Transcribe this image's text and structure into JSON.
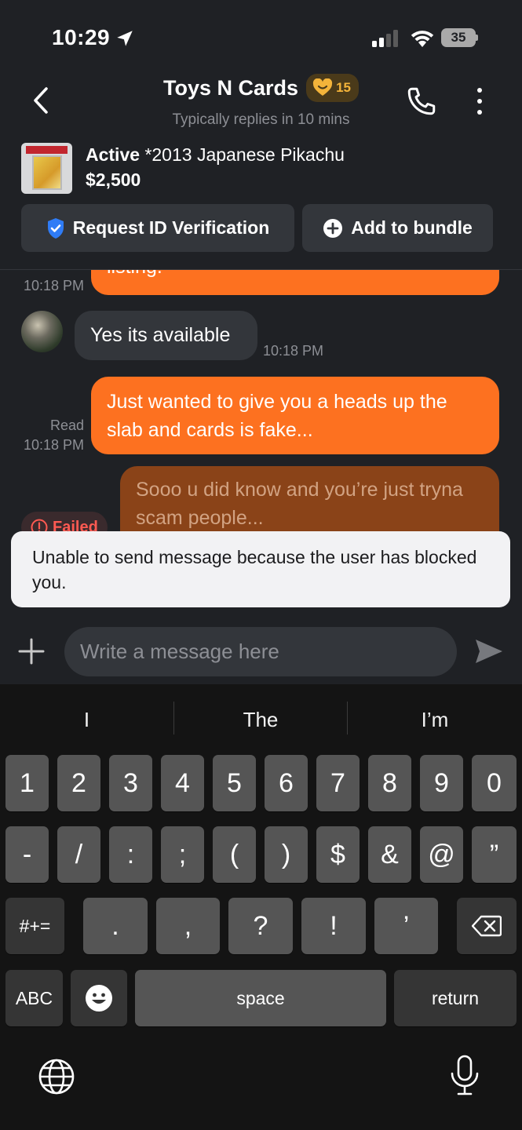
{
  "status_bar": {
    "time": "10:29",
    "battery": "35"
  },
  "header": {
    "title": "Toys N Cards",
    "badge_number": "15",
    "subtitle": "Typically replies in 10 mins"
  },
  "listing": {
    "status": "Active",
    "name": "*2013 Japanese Pikachu",
    "price": "$2,500",
    "verify_label": "Request ID Verification",
    "bundle_label": "Add to bundle"
  },
  "messages": [
    {
      "direction": "out",
      "text": "listing.",
      "time": "10:18 PM"
    },
    {
      "direction": "in",
      "text": "Yes its available",
      "time": "10:18 PM"
    },
    {
      "direction": "out",
      "text": "Just wanted to give you a heads up the slab and cards is fake...",
      "read": "Read",
      "time": "10:18 PM"
    },
    {
      "direction": "out",
      "status": "failed",
      "text": "Sooo u did know and you’re just tryna scam people...",
      "failed_label": "Failed"
    }
  ],
  "toast": {
    "text": "Unable to send message because the user has blocked you."
  },
  "composer": {
    "placeholder": "Write a message here"
  },
  "keyboard": {
    "suggestions": [
      "I",
      "The",
      "I’m"
    ],
    "row1": [
      "1",
      "2",
      "3",
      "4",
      "5",
      "6",
      "7",
      "8",
      "9",
      "0"
    ],
    "row2": [
      "-",
      "/",
      ":",
      ";",
      "(",
      ")",
      "$",
      "&",
      "@",
      "”"
    ],
    "row3": [
      "#+=",
      ".",
      ",",
      "?",
      "!",
      "’"
    ],
    "abc_label": "ABC",
    "space_label": "space",
    "return_label": "return"
  },
  "colors": {
    "accent_orange": "#fd7120",
    "badge_gold": "#f4b43a",
    "verify_blue": "#2f7cf6",
    "error_red": "#ff5a52"
  }
}
